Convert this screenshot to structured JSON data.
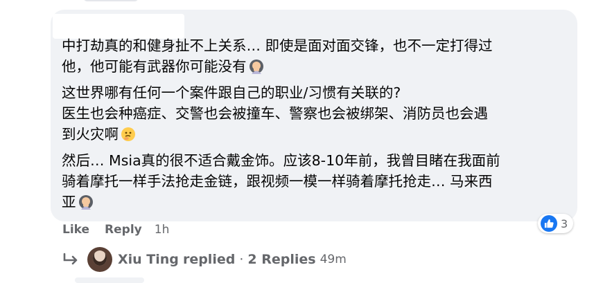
{
  "comment": {
    "paragraphs": [
      [
        "中打劫真的和健身扯不上关系… 即使是面对面交锋，也不一定打得过",
        "他，他可能有武器你可能没有"
      ],
      [
        "这世界哪有任何一个案件跟自己的职业/习惯有关联的?",
        "医生也会种癌症、交警也会被撞车、警察也会被绑架、消防员也会遇",
        "到火灾啊"
      ],
      [
        "然后… Msia真的很不适合戴金饰。应该8-10年前，我曾目睹在我面前",
        "骑着摩托一样手法抢走金链，跟视频一模一样骑着摩托抢走… 马来西",
        "亚"
      ]
    ],
    "reaction_count": "3",
    "reaction_icon": "like-icon",
    "bubble_color": "#f0f2f5"
  },
  "actions": {
    "like_label": "Like",
    "reply_label": "Reply",
    "timestamp": "1h"
  },
  "replies": {
    "name": "Xiu Ting",
    "verb": "replied",
    "separator": "·",
    "count_label": "2 Replies",
    "time": "49m"
  },
  "colors": {
    "text": "#050505",
    "secondary": "#65676b",
    "accent": "#1877f2"
  }
}
